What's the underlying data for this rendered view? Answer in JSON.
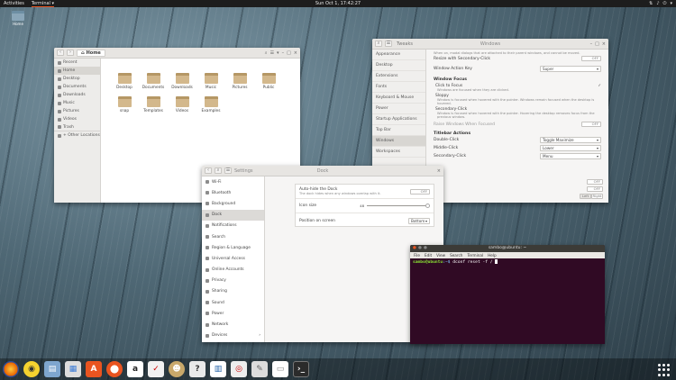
{
  "topbar": {
    "activities": "Activities",
    "app": "Terminal ▾",
    "clock": "Sun Oct 1, 17:42:27"
  },
  "desktop": {
    "home_icon": "Home"
  },
  "files": {
    "location": "Home",
    "sidebar": [
      "Recent",
      "Home",
      "Desktop",
      "Documents",
      "Downloads",
      "Music",
      "Pictures",
      "Videos",
      "Trash",
      "+ Other Locations"
    ],
    "folders": [
      "Desktop",
      "Documents",
      "Downloads",
      "Music",
      "Pictures",
      "Public",
      "snap",
      "Templates",
      "Videos",
      "Examples"
    ]
  },
  "tweaks": {
    "title": "Tweaks",
    "window_title": "Windows",
    "sidebar": [
      "Appearance",
      "Desktop",
      "Extensions",
      "Fonts",
      "Keyboard & Mouse",
      "Power",
      "Startup Applications",
      "Top Bar",
      "Windows",
      "Workspaces"
    ],
    "top_note": "When on, modal dialogs that are attached to their parent windows, and cannot be moved.",
    "resize_secondary": "Resize with Secondary-Click",
    "action_key_label": "Window Action Key",
    "action_key_value": "Super",
    "focus_heading": "Window Focus",
    "click_focus": "Click to Focus",
    "click_focus_desc": "Windows are focused when they are clicked.",
    "sloppy": "Sloppy",
    "sloppy_desc": "Window is focused when hovered with the pointer. Windows remain focused when the desktop is hovered.",
    "secondary": "Secondary-Click",
    "secondary_desc": "Window is focused when hovered with the pointer. Hovering the desktop removes focus from the previous window.",
    "raise": "Raise Windows When Focused",
    "titlebar_heading": "Titlebar Actions",
    "double": "Double-Click",
    "double_value": "Toggle Maximize",
    "middle": "Middle-Click",
    "middle_value": "Lower",
    "secondaryc": "Secondary-Click",
    "secondary_value": "Menu",
    "off": "OFF",
    "left": "Left",
    "right": "Right"
  },
  "settings": {
    "title": "Settings",
    "panel": "Dock",
    "sidebar": [
      "Wi-Fi",
      "Bluetooth",
      "Background",
      "Dock",
      "Notifications",
      "Search",
      "Region & Language",
      "Universal Access",
      "Online Accounts",
      "Privacy",
      "Sharing",
      "Sound",
      "Power",
      "Network",
      "Devices"
    ],
    "autohide": "Auto-hide the Dock",
    "autohide_desc": "The dock hides when any windows overlap with it.",
    "icon_size": "Icon size",
    "icon_size_value": "48",
    "position": "Position on screen",
    "position_value": "Bottom",
    "off": "OFF"
  },
  "terminal": {
    "title": "sambo@ubuntu: ~",
    "menu": [
      "File",
      "Edit",
      "View",
      "Search",
      "Terminal",
      "Help"
    ],
    "user": "sambo@ubuntu",
    "path": ":~$",
    "command": " dconf reset -f /"
  }
}
